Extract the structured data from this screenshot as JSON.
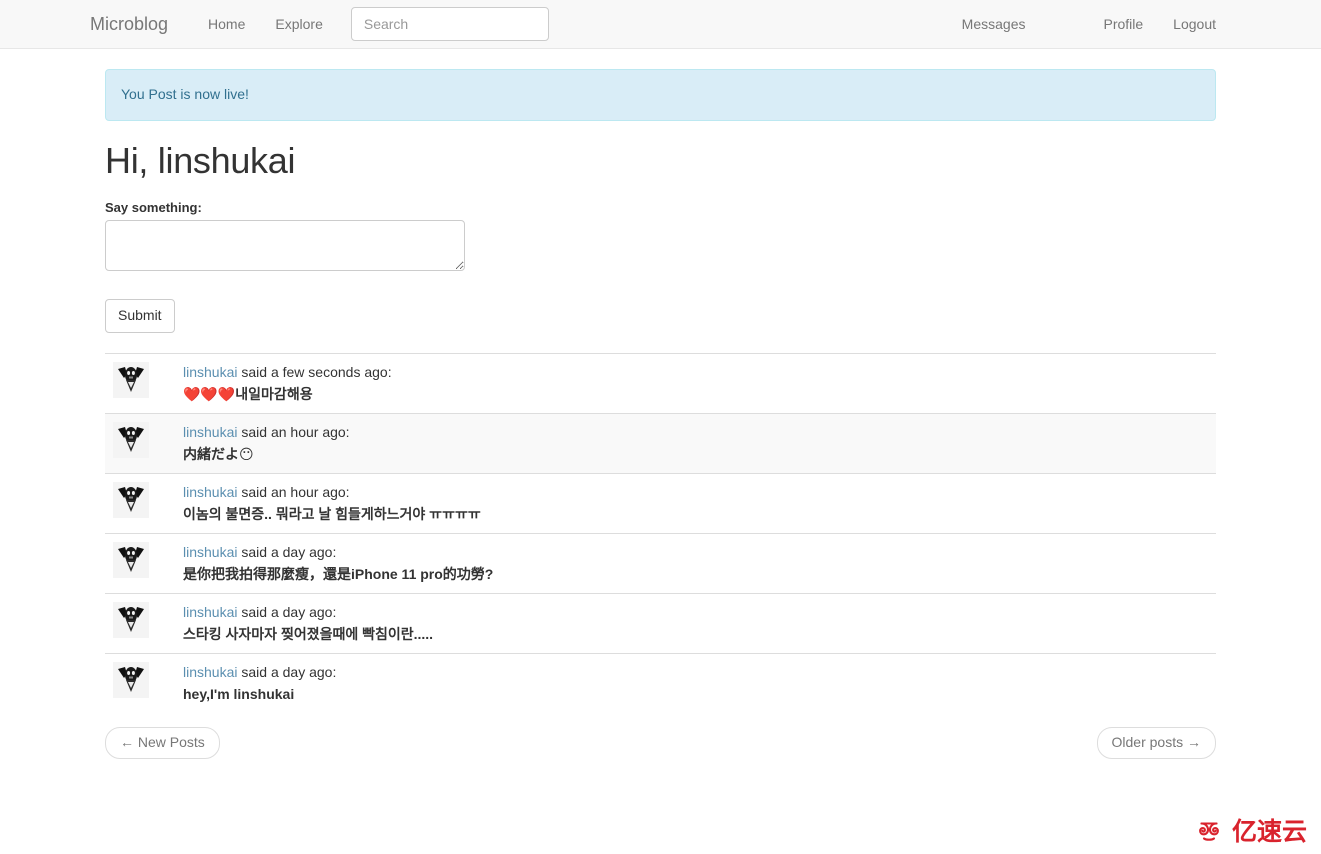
{
  "navbar": {
    "brand": "Microblog",
    "left_items": [
      {
        "label": "Home",
        "name": "nav-home"
      },
      {
        "label": "Explore",
        "name": "nav-explore"
      }
    ],
    "search": {
      "placeholder": "Search",
      "value": ""
    },
    "right_items": [
      {
        "label": "Messages",
        "name": "nav-messages"
      },
      {
        "label": "Profile",
        "name": "nav-profile"
      },
      {
        "label": "Logout",
        "name": "nav-logout"
      }
    ],
    "background": "#f8f8f8",
    "link_color": "#777777"
  },
  "alert": {
    "message": "You Post is now live!",
    "background": "#d9edf7",
    "border": "#bce8f1",
    "text_color": "#31708f"
  },
  "page": {
    "title": "Hi, linshukai"
  },
  "form": {
    "label": "Say something:",
    "textarea_value": "",
    "textarea_placeholder": "",
    "submit_label": "Submit"
  },
  "posts": [
    {
      "author": "linshukai",
      "meta_suffix": "said a few seconds ago:",
      "body": "❤️❤️❤️내일마감해용",
      "striped": false
    },
    {
      "author": "linshukai",
      "meta_suffix": "said an hour ago:",
      "body": "内緒だよ😶",
      "striped": true
    },
    {
      "author": "linshukai",
      "meta_suffix": "said an hour ago:",
      "body": "이놈의 불면증.. 뭐라고 날 힘들게하느거야 ㅠㅠㅠㅠ",
      "striped": false
    },
    {
      "author": "linshukai",
      "meta_suffix": "said a day ago:",
      "body": "是你把我拍得那麼瘦，還是iPhone 11 pro的功勞?",
      "striped": false
    },
    {
      "author": "linshukai",
      "meta_suffix": "said a day ago:",
      "body": "스타킹 사자마자 찢어졌을때에 빡침이란.....",
      "striped": false
    },
    {
      "author": "linshukai",
      "meta_suffix": "said a day ago:",
      "body": "hey,I'm linshukai",
      "striped": false
    }
  ],
  "pagination": {
    "newer_label": "← New Posts",
    "older_label": "Older posts →"
  },
  "watermark": {
    "text": "亿速云",
    "color": "#d9232d",
    "icon": "cloud-logo-icon"
  }
}
